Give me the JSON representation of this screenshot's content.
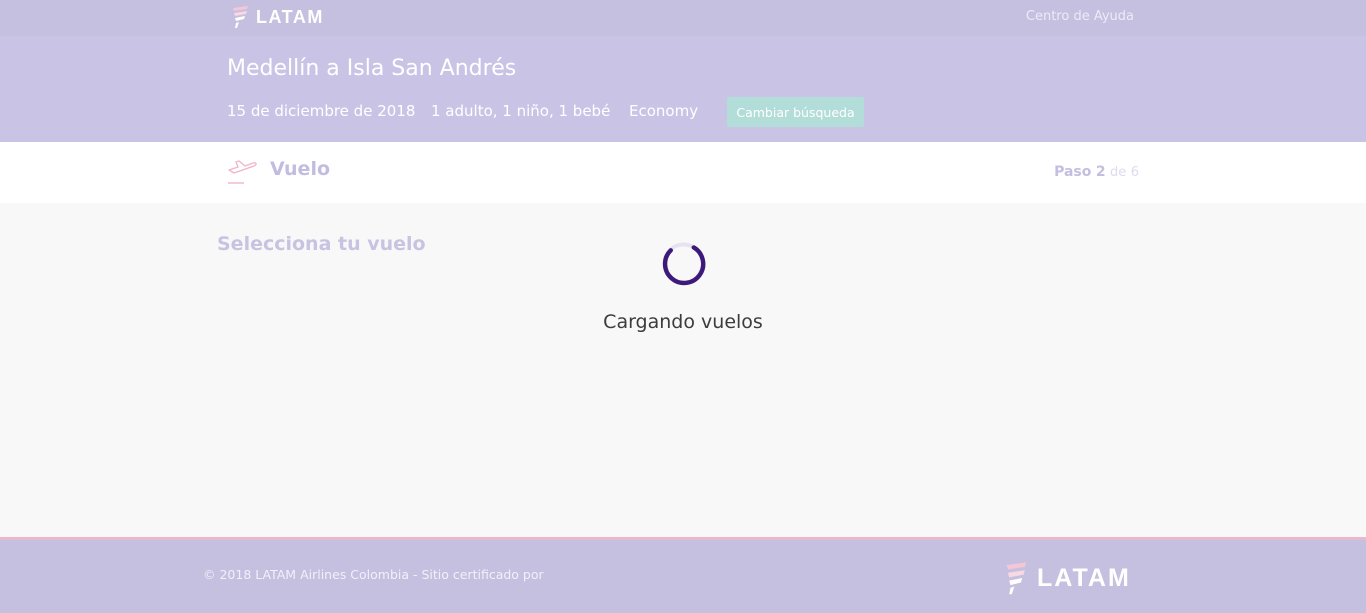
{
  "header": {
    "brand": "LATAM",
    "help_link": "Centro de Ayuda"
  },
  "search_summary": {
    "route": "Medellín a Isla San Andrés",
    "date": "15 de diciembre de 2018",
    "passengers": "1 adulto, 1 niño, 1 bebé",
    "cabin": "Economy",
    "change_button": "Cambiar búsqueda"
  },
  "step": {
    "icon": "plane-departure-icon",
    "title": "Vuelo",
    "label": "Paso",
    "current": "2",
    "of_label": "de",
    "total": "6"
  },
  "main": {
    "section_title": "Selecciona tu vuelo",
    "loading_text": "Cargando vuelos"
  },
  "footer": {
    "copyright": "© 2018 LATAM Airlines Colombia - Sitio certificado por",
    "brand": "LATAM"
  },
  "colors": {
    "brand_bar": "#c5bfe0",
    "summary_band": "#c9c4e6",
    "change_button": "#b3ddd8",
    "spinner": "#3d1a7a",
    "accent_pink": "#e8b8cc"
  }
}
